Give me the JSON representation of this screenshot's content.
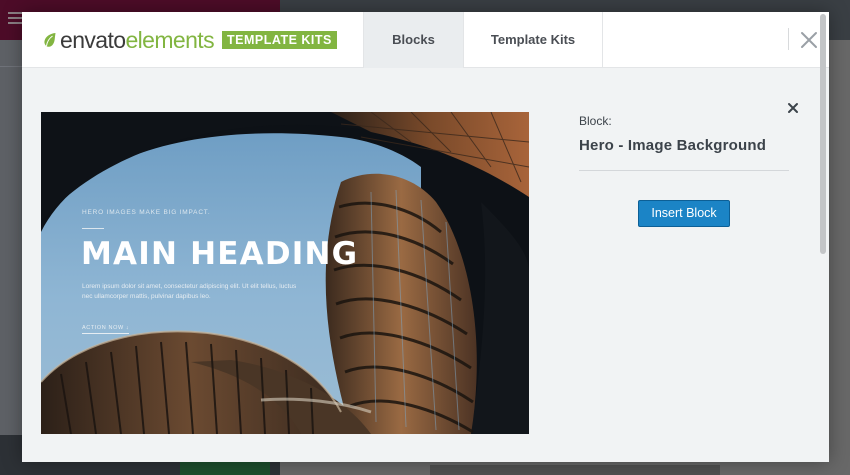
{
  "modal": {
    "brand": {
      "word1": "envato",
      "word2": "elements",
      "badge": "TEMPLATE KITS"
    },
    "tabs": [
      {
        "label": "Blocks",
        "active": true
      },
      {
        "label": "Template Kits",
        "active": false
      }
    ],
    "close_icon": "close-icon"
  },
  "preview": {
    "kicker": "HERO IMAGES MAKE BIG IMPACT.",
    "heading": "MAIN HEADING",
    "text": "Lorem ipsum dolor sit amet, consectetur adipiscing elit. Ut elit tellus, luctus nec ullamcorper mattis, pulvinar dapibus leo.",
    "link": "ACTION NOW"
  },
  "panel": {
    "label": "Block:",
    "name": "Hero - Image Background",
    "button": "Insert Block"
  },
  "colors": {
    "brand_green": "#82b541",
    "button_blue": "#1b84c6",
    "text_dark": "#3c434a"
  }
}
